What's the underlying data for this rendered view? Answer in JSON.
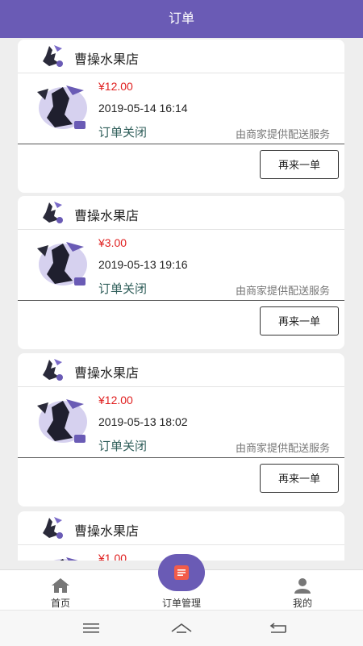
{
  "header": {
    "title": "订单"
  },
  "orders": [
    {
      "shop": "曹操水果店",
      "price": "¥12.00",
      "time": "2019-05-14 16:14",
      "status": "订单关闭",
      "delivery": "由商家提供配送服务",
      "reorder": "再来一单"
    },
    {
      "shop": "曹操水果店",
      "price": "¥3.00",
      "time": "2019-05-13 19:16",
      "status": "订单关闭",
      "delivery": "由商家提供配送服务",
      "reorder": "再来一单"
    },
    {
      "shop": "曹操水果店",
      "price": "¥12.00",
      "time": "2019-05-13 18:02",
      "status": "订单关闭",
      "delivery": "由商家提供配送服务",
      "reorder": "再来一单"
    },
    {
      "shop": "曹操水果店",
      "price": "¥1.00"
    }
  ],
  "tabs": [
    {
      "label": "首页",
      "icon": "home-icon"
    },
    {
      "label": "订单管理",
      "icon": "order-icon",
      "active": true
    },
    {
      "label": "我的",
      "icon": "user-icon"
    }
  ],
  "colors": {
    "brand": "#6a5bb5",
    "price": "#e02020",
    "status": "#2f5e5a"
  }
}
